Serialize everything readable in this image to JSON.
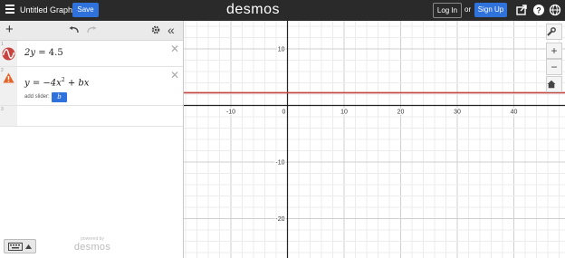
{
  "header": {
    "graph_title": "Untitled Graph",
    "save_label": "Save",
    "brand": "desmos",
    "login_label": "Log In",
    "or_text": "or",
    "signup_label": "Sign Up",
    "icons": [
      "share-icon",
      "help-icon",
      "globe-icon"
    ]
  },
  "expressions": [
    {
      "number": "1",
      "latex_parts": {
        "lhs": "2y",
        "rhs": "4.5"
      },
      "color": "#c74440",
      "status": "graphed"
    },
    {
      "number": "2",
      "latex_parts": {
        "lhs": "y",
        "rhs_a": "−4x",
        "exp": "2",
        "rhs_b": "+ bx"
      },
      "status": "warning",
      "add_slider_label": "add slider:",
      "slider_variable": "b"
    },
    {
      "number": "3"
    }
  ],
  "footer": {
    "powered_by": "powered by",
    "brand": "desmos"
  },
  "graph": {
    "x_ticks": [
      "-10",
      "0",
      "10",
      "20",
      "30",
      "40"
    ],
    "y_ticks": [
      "10",
      "-10",
      "-20"
    ],
    "line_color": "#c74440",
    "line_y_value": 2.25
  }
}
